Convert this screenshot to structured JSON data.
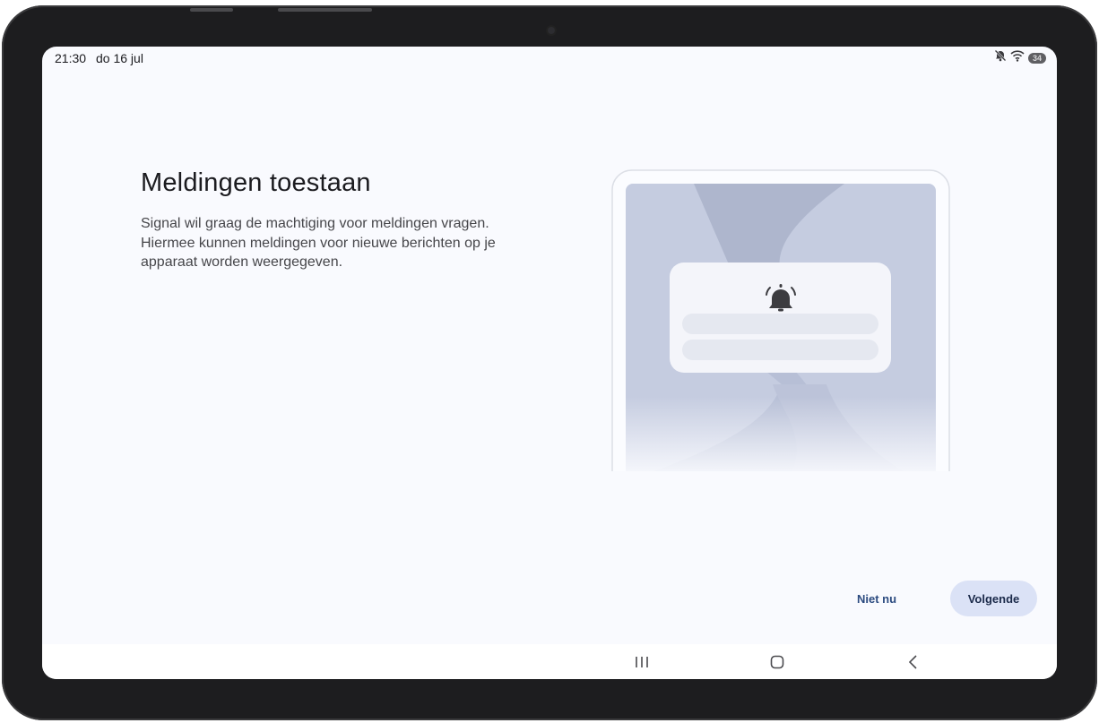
{
  "status_bar": {
    "time": "21:30",
    "date": "do 16 jul",
    "battery": "34",
    "icons": [
      "mute-icon",
      "wifi-icon",
      "battery-icon"
    ]
  },
  "onboarding": {
    "title": "Meldingen toestaan",
    "description": "Signal wil graag de machtiging voor meldingen vragen. Hiermee kunnen meldingen voor nieuwe berichten op je apparaat worden weergegeven.",
    "illustration_icon": "bell-alert-icon"
  },
  "actions": {
    "skip_label": "Niet nu",
    "next_label": "Volgende"
  },
  "nav_bar": {
    "icons": [
      "recents-icon",
      "home-icon",
      "back-icon"
    ]
  },
  "colors": {
    "screen_bg": "#f9fafe",
    "accent_text": "#2c4b80",
    "primary_button_bg": "#dbe2f6",
    "illustration_bg": "#c5cce0"
  }
}
